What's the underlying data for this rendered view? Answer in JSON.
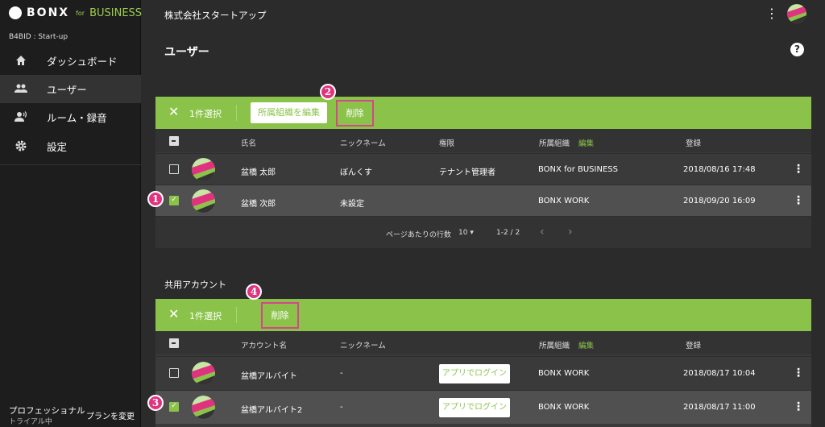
{
  "app": {
    "brand_main": "BONX",
    "brand_for": "for",
    "brand_business": "BUSINESS",
    "tenant_id": "B4BID : Start-up"
  },
  "sidebar": {
    "items": [
      {
        "label": "ダッシュボード",
        "icon": "home-icon"
      },
      {
        "label": "ユーザー",
        "icon": "people-icon",
        "active": true
      },
      {
        "label": "ルーム・録音",
        "icon": "voice-room-icon"
      },
      {
        "label": "設定",
        "icon": "gear-icon"
      }
    ],
    "plan": {
      "name": "プロフェッショナル",
      "status": "トライアル中",
      "change_label": "プランを変更"
    }
  },
  "header": {
    "company": "株式会社スタートアップ",
    "title": "ユーザー"
  },
  "users_table": {
    "selection_count": "1件選択",
    "edit_org_label": "所属組織を編集",
    "delete_label": "削除",
    "columns": {
      "name": "氏名",
      "nickname": "ニックネーム",
      "role": "権限",
      "org": "所属組織",
      "org_edit": "編集",
      "registered": "登録"
    },
    "rows": [
      {
        "name": "盆橋 太郎",
        "nickname": "ぼんくす",
        "role": "テナント管理者",
        "org": "BONX for BUSINESS",
        "registered": "2018/08/16 17:48",
        "checked": false
      },
      {
        "name": "盆橋 次郎",
        "nickname": "未設定",
        "role": "",
        "org": "BONX WORK",
        "registered": "2018/09/20 16:09",
        "checked": true
      }
    ],
    "footer": {
      "rows_per_page_label": "ページあたりの行数",
      "rows_per_page": "10",
      "range": "1-2 / 2"
    }
  },
  "shared_table": {
    "section_title": "共用アカウント",
    "selection_count": "1件選択",
    "delete_label": "削除",
    "columns": {
      "name": "アカウント名",
      "nickname": "ニックネーム",
      "org": "所属組織",
      "org_edit": "編集",
      "registered": "登録"
    },
    "login_label": "アプリでログイン",
    "rows": [
      {
        "name": "盆橋アルバイト",
        "nickname": "-",
        "org": "BONX WORK",
        "registered": "2018/08/17 10:04",
        "checked": false
      },
      {
        "name": "盆橋アルバイト2",
        "nickname": "-",
        "org": "BONX WORK",
        "registered": "2018/08/17 11:00",
        "checked": true
      }
    ]
  },
  "annotations": {
    "b1": "1",
    "b2": "2",
    "b3": "3",
    "b4": "4"
  },
  "colors": {
    "accent": "#8bc34a",
    "highlight": "#d4478a"
  }
}
